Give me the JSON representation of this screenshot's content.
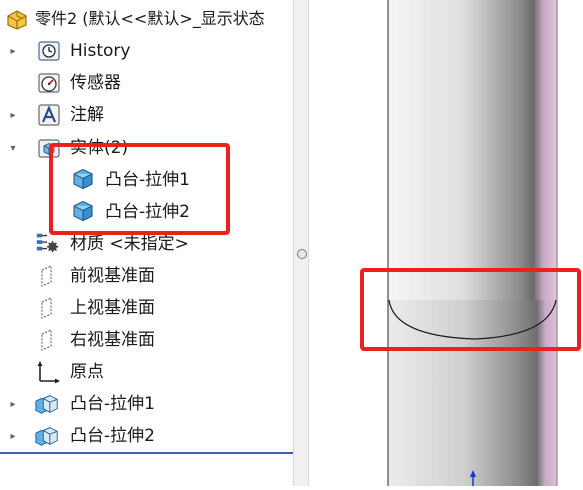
{
  "tree": {
    "root_label": "零件2  (默认<<默认>_显示状态",
    "items": [
      {
        "label": "History",
        "icon": "history-clock-icon",
        "expander": "collapsed"
      },
      {
        "label": "传感器",
        "icon": "sensor-gauge-icon",
        "expander": "none"
      },
      {
        "label": "注解",
        "icon": "annotation-a-icon",
        "expander": "collapsed"
      },
      {
        "label": "实体(2)",
        "icon": "solid-bodies-folder-icon",
        "expander": "expanded"
      },
      {
        "label": "凸台-拉伸1",
        "icon": "solid-body-cube-icon",
        "expander": "none"
      },
      {
        "label": "凸台-拉伸2",
        "icon": "solid-body-cube-icon",
        "expander": "none"
      },
      {
        "label": "材质 <未指定>",
        "icon": "material-icon",
        "expander": "none"
      },
      {
        "label": "前视基准面",
        "icon": "plane-icon",
        "expander": "none"
      },
      {
        "label": "上视基准面",
        "icon": "plane-icon",
        "expander": "none"
      },
      {
        "label": "右视基准面",
        "icon": "plane-icon",
        "expander": "none"
      },
      {
        "label": "原点",
        "icon": "origin-icon",
        "expander": "none"
      },
      {
        "label": "凸台-拉伸1",
        "icon": "extrude-feature-icon",
        "expander": "collapsed"
      },
      {
        "label": "凸台-拉伸2",
        "icon": "extrude-feature-icon",
        "expander": "collapsed"
      }
    ]
  },
  "colors": {
    "highlight_red": "#ee1f1f",
    "cylinder_light": "#f4f4f4",
    "cylinder_mid": "#c9c9c9",
    "cylinder_dark": "#5a5a5a",
    "cylinder_pink": "#d8b8d4",
    "axis_blue": "#1432e0"
  }
}
